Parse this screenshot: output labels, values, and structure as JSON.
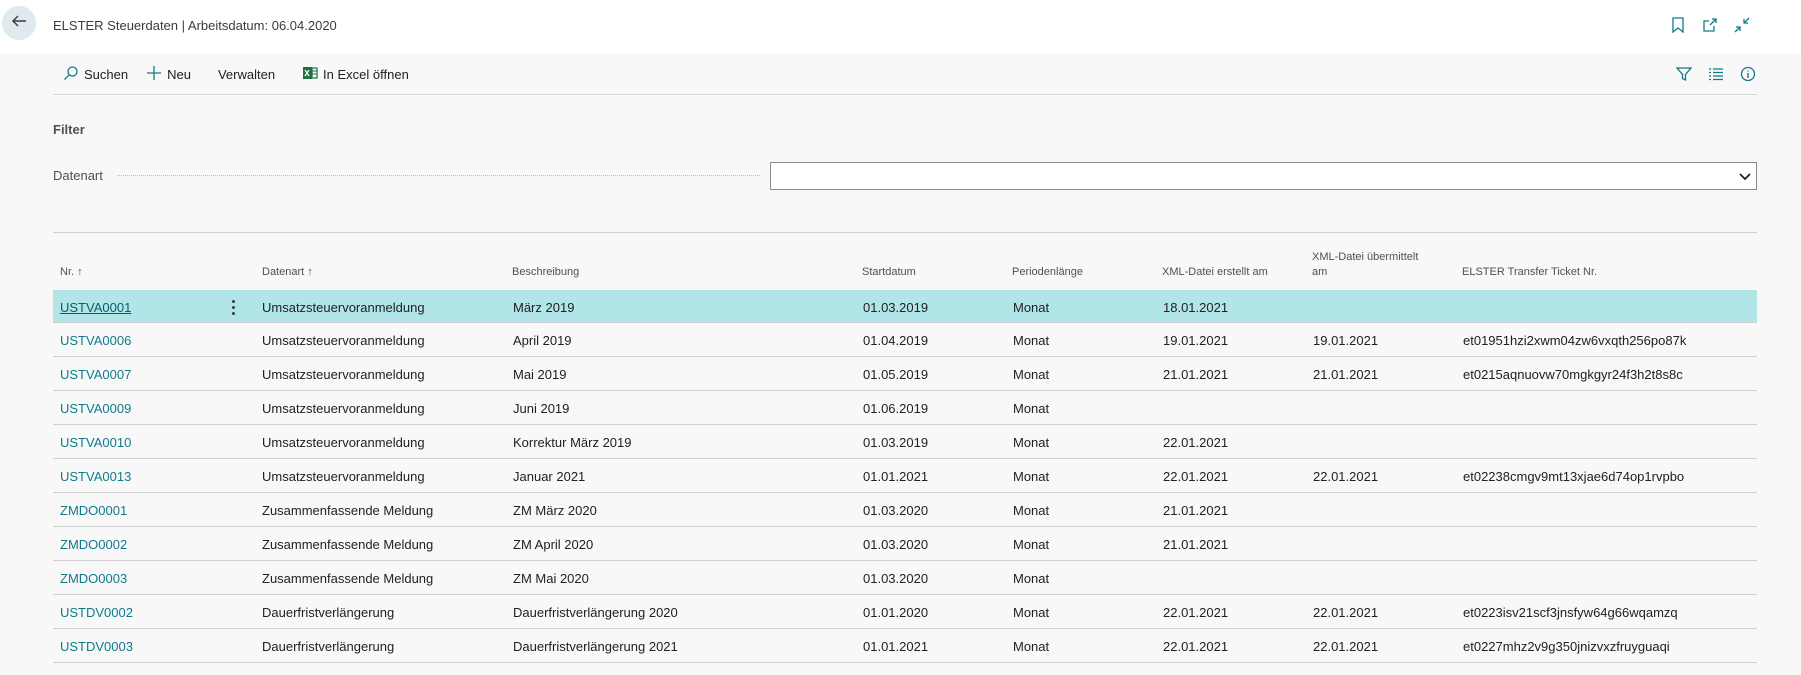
{
  "header": {
    "title": "ELSTER Steuerdaten | Arbeitsdatum: 06.04.2020",
    "back_icon": "back-arrow-icon",
    "icons": [
      "bookmark-icon",
      "open-new-window-icon",
      "collapse-icon"
    ]
  },
  "actions": {
    "search_label": "Suchen",
    "new_label": "Neu",
    "manage_label": "Verwalten",
    "excel_label": "In Excel öffnen",
    "right_icons": [
      "filter-icon",
      "list-view-icon",
      "info-icon"
    ]
  },
  "filter": {
    "heading": "Filter",
    "field_label": "Datenart",
    "field_value": ""
  },
  "table": {
    "columns": {
      "nr": "Nr. ↑",
      "datenart": "Datenart ↑",
      "beschreibung": "Beschreibung",
      "startdatum": "Startdatum",
      "periodenlaenge": "Periodenlänge",
      "xml_erstellt": "XML-Datei erstellt am",
      "xml_uebermittelt_1": "XML-Datei übermittelt",
      "xml_uebermittelt_2": "am",
      "ticket": "ELSTER Transfer Ticket Nr."
    },
    "rows": [
      {
        "nr": "USTVA0001",
        "datenart": "Umsatzsteuervoranmeldung",
        "beschreibung": "März 2019",
        "startdatum": "01.03.2019",
        "periode": "Monat",
        "erstellt": "18.01.2021",
        "uebermittelt": "",
        "ticket": ""
      },
      {
        "nr": "USTVA0006",
        "datenart": "Umsatzsteuervoranmeldung",
        "beschreibung": "April 2019",
        "startdatum": "01.04.2019",
        "periode": "Monat",
        "erstellt": "19.01.2021",
        "uebermittelt": "19.01.2021",
        "ticket": "et01951hzi2xwm04zw6vxqth256po87k"
      },
      {
        "nr": "USTVA0007",
        "datenart": "Umsatzsteuervoranmeldung",
        "beschreibung": "Mai 2019",
        "startdatum": "01.05.2019",
        "periode": "Monat",
        "erstellt": "21.01.2021",
        "uebermittelt": "21.01.2021",
        "ticket": "et0215aqnuovw70mgkgyr24f3h2t8s8c"
      },
      {
        "nr": "USTVA0009",
        "datenart": "Umsatzsteuervoranmeldung",
        "beschreibung": "Juni 2019",
        "startdatum": "01.06.2019",
        "periode": "Monat",
        "erstellt": "",
        "uebermittelt": "",
        "ticket": ""
      },
      {
        "nr": "USTVA0010",
        "datenart": "Umsatzsteuervoranmeldung",
        "beschreibung": "Korrektur März 2019",
        "startdatum": "01.03.2019",
        "periode": "Monat",
        "erstellt": "22.01.2021",
        "uebermittelt": "",
        "ticket": ""
      },
      {
        "nr": "USTVA0013",
        "datenart": "Umsatzsteuervoranmeldung",
        "beschreibung": "Januar 2021",
        "startdatum": "01.01.2021",
        "periode": "Monat",
        "erstellt": "22.01.2021",
        "uebermittelt": "22.01.2021",
        "ticket": "et02238cmgv9mt13xjae6d74op1rvpbo"
      },
      {
        "nr": "ZMDO0001",
        "datenart": "Zusammenfassende Meldung",
        "beschreibung": "ZM März 2020",
        "startdatum": "01.03.2020",
        "periode": "Monat",
        "erstellt": "21.01.2021",
        "uebermittelt": "",
        "ticket": ""
      },
      {
        "nr": "ZMDO0002",
        "datenart": "Zusammenfassende Meldung",
        "beschreibung": "ZM April 2020",
        "startdatum": "01.03.2020",
        "periode": "Monat",
        "erstellt": "21.01.2021",
        "uebermittelt": "",
        "ticket": ""
      },
      {
        "nr": "ZMDO0003",
        "datenart": "Zusammenfassende Meldung",
        "beschreibung": "ZM Mai 2020",
        "startdatum": "01.03.2020",
        "periode": "Monat",
        "erstellt": "",
        "uebermittelt": "",
        "ticket": ""
      },
      {
        "nr": "USTDV0002",
        "datenart": "Dauerfristverlängerung",
        "beschreibung": "Dauerfristverlängerung 2020",
        "startdatum": "01.01.2020",
        "periode": "Monat",
        "erstellt": "22.01.2021",
        "uebermittelt": "22.01.2021",
        "ticket": "et0223isv21scf3jnsfyw64g66wqamzq"
      },
      {
        "nr": "USTDV0003",
        "datenart": "Dauerfristverlängerung",
        "beschreibung": "Dauerfristverlängerung 2021",
        "startdatum": "01.01.2021",
        "periode": "Monat",
        "erstellt": "22.01.2021",
        "uebermittelt": "22.01.2021",
        "ticket": "et0227mhz2v9g350jnizvxzfruyguaqi"
      }
    ]
  },
  "colors": {
    "accent": "#0f7b8a",
    "selected_row": "#b2e5e8",
    "back_button_bg": "#dfe9ee"
  }
}
